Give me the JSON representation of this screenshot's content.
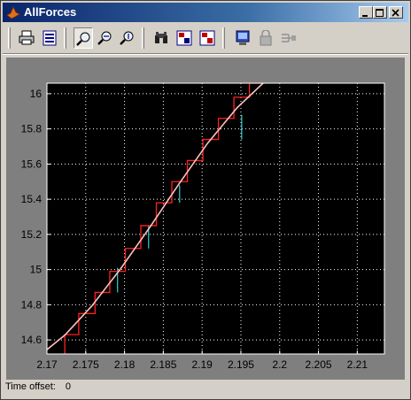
{
  "window": {
    "title": "AllForces"
  },
  "toolbar": {
    "buttons": [
      {
        "name": "print-icon"
      },
      {
        "name": "parameters-icon"
      },
      {
        "name": "zoom-icon",
        "pressed": true
      },
      {
        "name": "zoom-x-icon"
      },
      {
        "name": "zoom-y-icon"
      },
      {
        "name": "autoscale-binoculars-icon"
      },
      {
        "name": "save-axes-settings-icon"
      },
      {
        "name": "restore-axes-settings-icon"
      },
      {
        "name": "floating-scope-icon"
      },
      {
        "name": "lock-axes-icon"
      },
      {
        "name": "signal-selection-icon"
      }
    ]
  },
  "status": {
    "label": "Time offset:",
    "value": "0"
  },
  "chart_data": {
    "type": "line",
    "title": "",
    "xlabel": "",
    "ylabel": "",
    "xlim": [
      2.17,
      2.2135
    ],
    "ylim": [
      14.52,
      16.06
    ],
    "grid": true,
    "xticks": [
      "2.17",
      "2.175",
      "2.18",
      "2.185",
      "2.19",
      "2.195",
      "2.2",
      "2.205",
      "2.21"
    ],
    "yticks": [
      "14.6",
      "14.8",
      "15",
      "15.2",
      "15.4",
      "15.6",
      "15.8",
      "16"
    ],
    "colors": {
      "background": "#000000",
      "grid": "#ffffff",
      "smooth": "#ffc0c0",
      "staircase": "#ff2020",
      "held": "#30d0d0"
    },
    "series": [
      {
        "type": "line",
        "x": [
          2.1693,
          2.1723,
          2.1758,
          2.1795,
          2.1833,
          2.187,
          2.1907,
          2.1945,
          2.1981,
          2.2001
        ],
        "y": [
          14.52,
          14.627,
          14.794,
          15.005,
          15.243,
          15.486,
          15.718,
          15.92,
          16.07,
          16.14
        ]
      },
      {
        "type": "step",
        "x": [
          2.1723,
          2.1723,
          2.1741,
          2.1741,
          2.1762,
          2.1762,
          2.1781,
          2.1781,
          2.1801,
          2.1801,
          2.1821,
          2.1821,
          2.1841,
          2.1841,
          2.1861,
          2.1861,
          2.1881,
          2.1881,
          2.1901,
          2.1901,
          2.1921,
          2.1921,
          2.1941,
          2.1941,
          2.1961,
          2.1961,
          2.1981,
          2.1981,
          2.2001,
          2.2001
        ],
        "y": [
          14.52,
          14.63,
          14.63,
          14.75,
          14.75,
          14.87,
          14.87,
          14.99,
          14.99,
          15.12,
          15.12,
          15.25,
          15.25,
          15.38,
          15.38,
          15.5,
          15.5,
          15.62,
          15.62,
          15.74,
          15.74,
          15.86,
          15.86,
          15.98,
          15.98,
          16.06,
          16.06,
          16.12,
          16.12,
          16.14
        ]
      },
      {
        "type": "segments",
        "x": [
          2.1791,
          2.1831,
          2.1871,
          2.1951
        ],
        "y0": [
          14.87,
          15.12,
          15.38,
          15.74
        ],
        "y1": [
          15.01,
          15.25,
          15.48,
          15.88
        ]
      }
    ]
  }
}
